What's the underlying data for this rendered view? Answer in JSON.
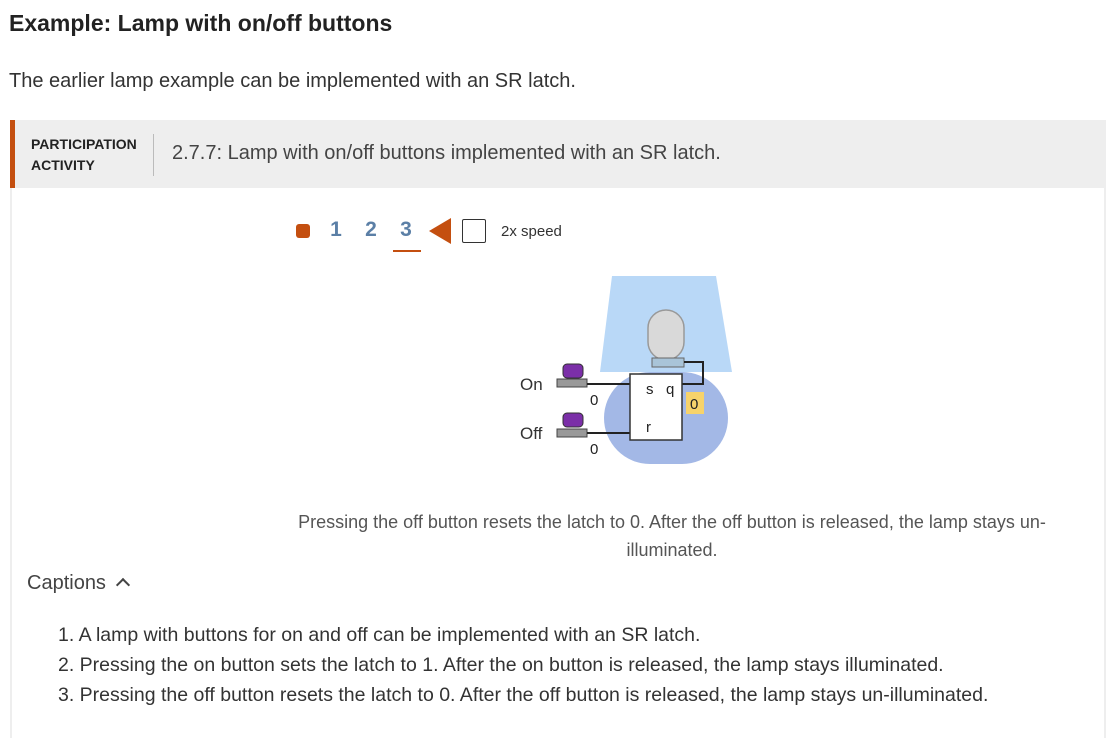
{
  "section": {
    "title": "Example: Lamp with on/off buttons",
    "intro": "The earlier lamp example can be implemented with an SR latch."
  },
  "activity": {
    "label_line1": "PARTICIPATION",
    "label_line2": "ACTIVITY",
    "title": "2.7.7: Lamp with on/off buttons implemented with an SR latch."
  },
  "controls": {
    "steps": [
      "1",
      "2",
      "3"
    ],
    "current_step": 3,
    "speed_label": "2x speed",
    "speed_checked": false
  },
  "diagram": {
    "on_label": "On",
    "off_label": "Off",
    "on_wire_value": "0",
    "off_wire_value": "0",
    "latch_s": "s",
    "latch_q": "q",
    "latch_r": "r",
    "q_value": "0",
    "colors": {
      "button_cap": "#7b2fa8",
      "lamp_shade": "#b9d8f7",
      "glow": "#a3b8e6",
      "bulb": "#d9d9d9",
      "value_highlight": "#f7d36b",
      "accent": "#c44f10"
    }
  },
  "step_caption": "Pressing the off button resets the latch to 0. After the off button is released, the lamp stays un-illuminated.",
  "captions": {
    "toggle_label": "Captions",
    "items": [
      "1. A lamp with buttons for on and off can be implemented with an SR latch.",
      "2. Pressing the on button sets the latch to 1. After the on button is released, the lamp stays illuminated.",
      "3. Pressing the off button resets the latch to 0. After the off button is released, the lamp stays un-illuminated."
    ]
  }
}
